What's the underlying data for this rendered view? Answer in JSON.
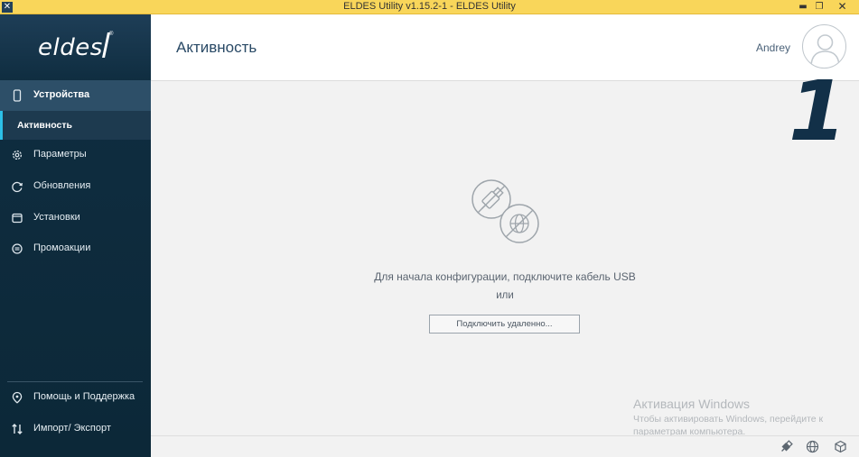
{
  "window": {
    "title": "ELDES Utility v1.15.2-1 - ELDES Utility",
    "app_icon": "eldes-x-icon",
    "min_glyph": "▬",
    "max_glyph": "❐",
    "close_glyph": "✕"
  },
  "sidebar": {
    "logo_text": "eldes",
    "logo_reg": "®",
    "items": [
      {
        "label": "Устройства",
        "icon": "device-icon"
      },
      {
        "label": "Активность",
        "icon": ""
      },
      {
        "label": "Параметры",
        "icon": "gear-icon"
      },
      {
        "label": "Обновления",
        "icon": "refresh-icon"
      },
      {
        "label": "Установки",
        "icon": "installs-icon"
      },
      {
        "label": "Промоакции",
        "icon": "promo-icon"
      },
      {
        "label": "Помощь и Поддержка",
        "icon": "help-icon"
      },
      {
        "label": "Импорт/ Экспорт",
        "icon": "import-export-icon"
      }
    ]
  },
  "header": {
    "title": "Активность",
    "user_name": "Andrey",
    "avatar_icon": "user-avatar-icon"
  },
  "annotation": {
    "number": "1"
  },
  "main": {
    "message": "Для начала конфигурации, подключите кабель USB",
    "or": "или",
    "remote_button": "Подключить удаленно..."
  },
  "watermark": {
    "title": "Активация Windows",
    "subtitle": "Чтобы активировать Windows, перейдите к параметрам компьютера."
  },
  "footer": {
    "icons": [
      "usb-plug-icon",
      "globe-icon",
      "box-icon"
    ]
  },
  "colors": {
    "titlebar": "#f9d65a",
    "sidebar": "#0f2d40",
    "accent": "#2cc0e8",
    "title_text": "#2a4a66"
  }
}
